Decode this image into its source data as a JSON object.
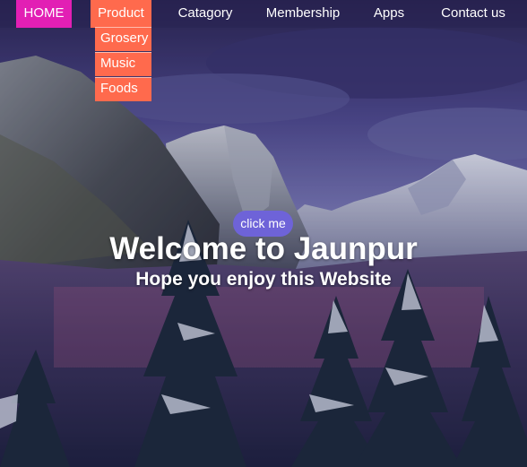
{
  "nav": {
    "items": [
      {
        "label": "HOME"
      },
      {
        "label": "Product"
      },
      {
        "label": "Catagory"
      },
      {
        "label": "Membership"
      },
      {
        "label": "Apps"
      },
      {
        "label": "Contact us"
      }
    ],
    "product_dropdown": [
      {
        "label": "Grosery"
      },
      {
        "label": "Music"
      },
      {
        "label": "Foods"
      }
    ]
  },
  "hero": {
    "button_label": "click me",
    "title": "Welcome to Jaunpur",
    "subtitle": "Hope you enjoy this Website"
  },
  "colors": {
    "home_active": "#e21fb4",
    "product_hover": "#ff6a4d",
    "dropdown_bg": "#ff6a4d",
    "button_bg": "#6e63d8",
    "sky": "#4b4a8f"
  }
}
